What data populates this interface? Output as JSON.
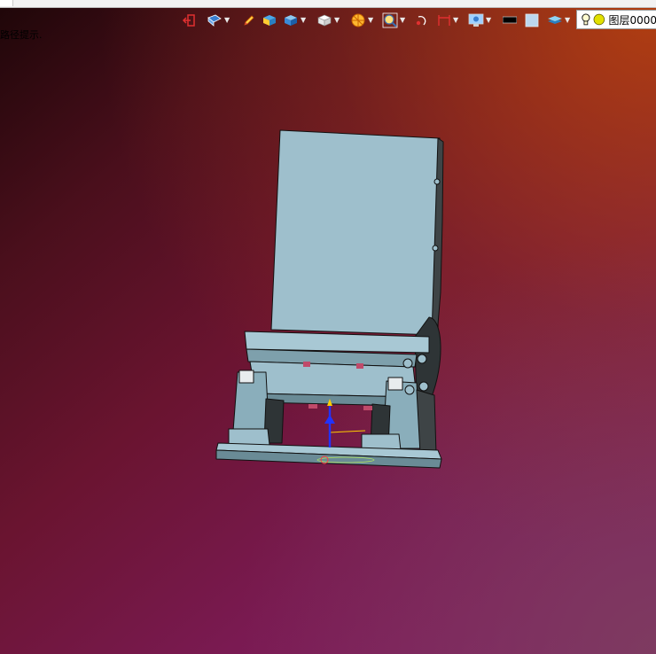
{
  "status": {
    "message": "路径提示."
  },
  "toolbar": {
    "tools": [
      {
        "name": "exit-icon",
        "caret": false
      },
      {
        "name": "view-orient-icon",
        "caret": true
      },
      {
        "name": "pencil-icon",
        "caret": false
      },
      {
        "name": "shaded-box-icon",
        "caret": false
      },
      {
        "name": "solid-box-icon",
        "caret": true
      },
      {
        "name": "white-cube-icon",
        "caret": true
      },
      {
        "name": "section-icon",
        "caret": true
      },
      {
        "name": "zoom-icon",
        "caret": true
      },
      {
        "name": "rotate-point-icon",
        "caret": false
      },
      {
        "name": "measure-icon",
        "caret": true
      },
      {
        "name": "display-mode-icon",
        "caret": true
      },
      {
        "name": "black-bar-icon",
        "caret": false
      },
      {
        "name": "plain-square-icon",
        "caret": false
      },
      {
        "name": "layer-stack-icon",
        "caret": true
      }
    ],
    "layer": {
      "label": "图层0000"
    }
  },
  "colors": {
    "model_fill": "#9ebfcc",
    "model_edge": "#111111",
    "axis_y": "#2233ff",
    "axis_x": "#ffcc00"
  }
}
